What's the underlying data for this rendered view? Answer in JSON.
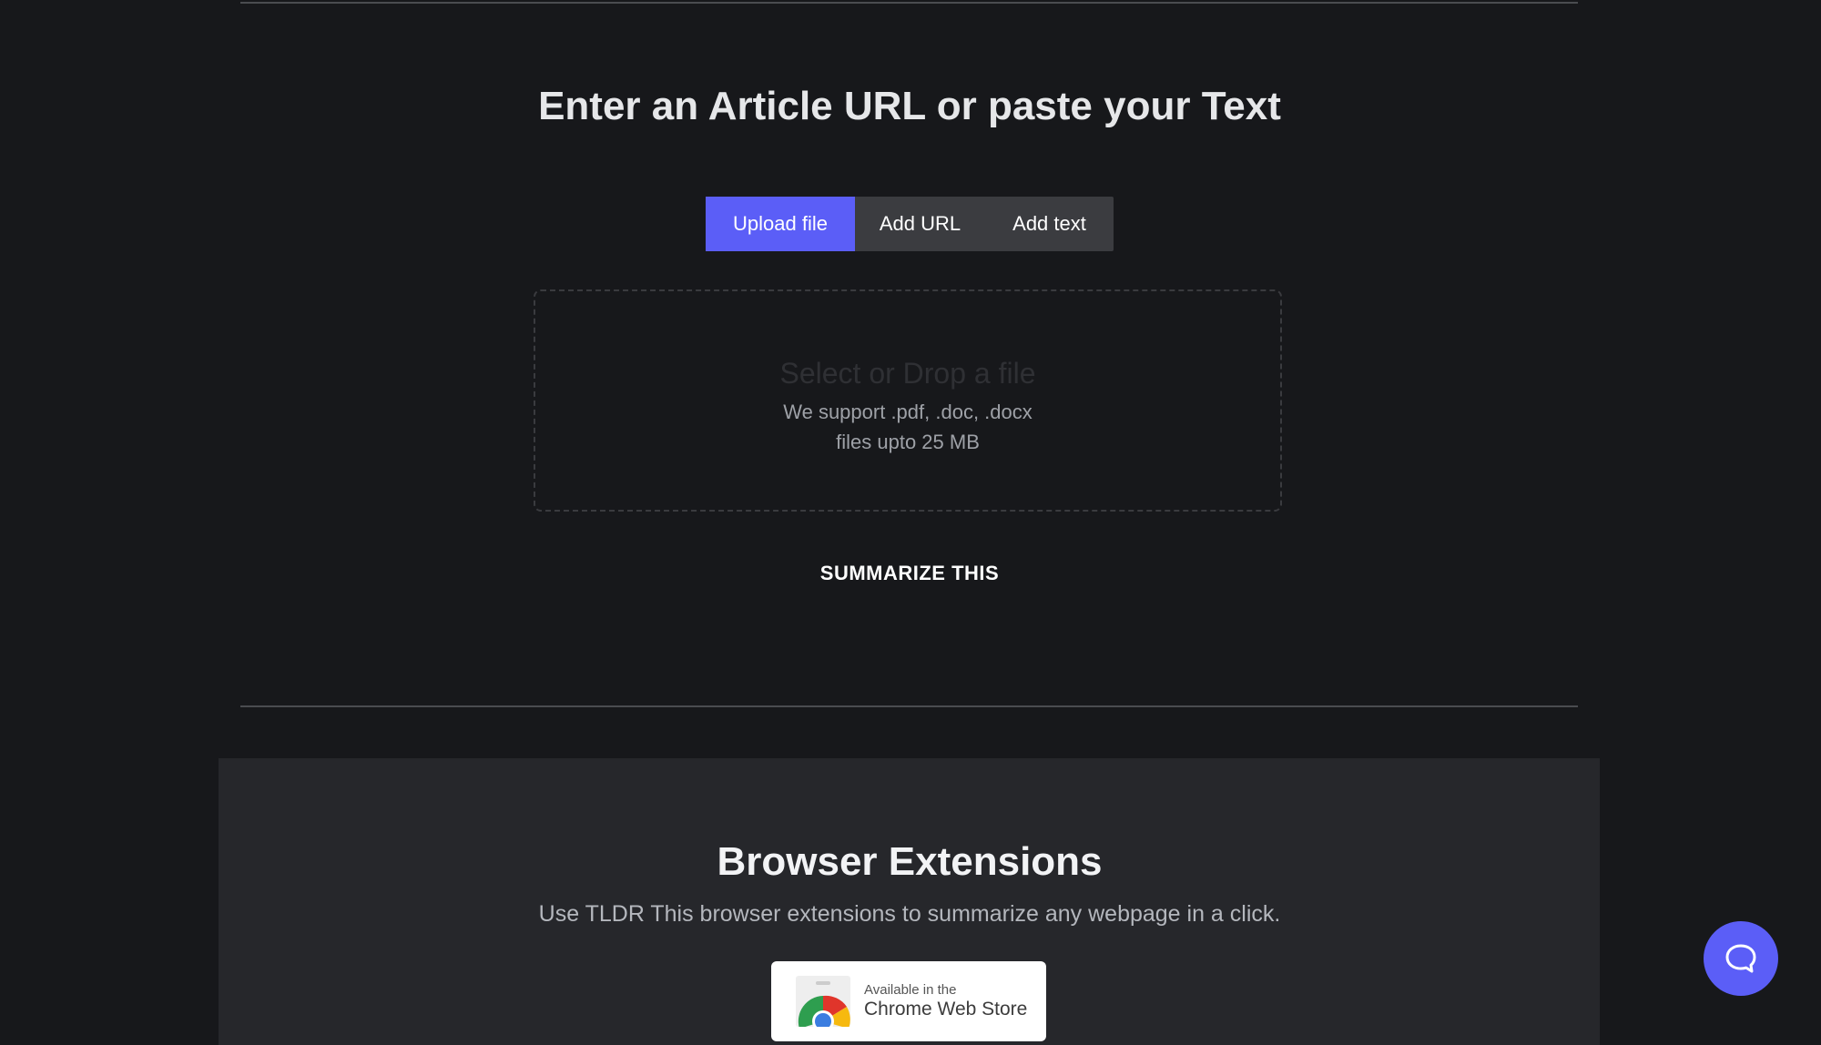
{
  "main": {
    "heading": "Enter an Article URL or paste your Text",
    "tabs": [
      {
        "label": "Upload file",
        "active": true
      },
      {
        "label": "Add URL",
        "active": false
      },
      {
        "label": "Add text",
        "active": false
      }
    ],
    "dropzone": {
      "title": "Select or Drop a file",
      "support_line1": "We support .pdf, .doc, .docx",
      "support_line2": "files upto 25 MB"
    },
    "summarize_label": "SUMMARIZE THIS"
  },
  "extensions": {
    "title": "Browser Extensions",
    "subtitle": "Use TLDR This browser extensions to summarize any webpage in a click.",
    "chrome_badge": {
      "small_text": "Available in the",
      "large_text": "Chrome Web Store",
      "icon": "chrome-web-store-icon"
    }
  },
  "chat": {
    "icon": "chat-bubble-icon"
  },
  "colors": {
    "background": "#17181b",
    "accent": "#5b5ef7",
    "tab_inactive": "#3b3c40",
    "section_background": "#26272b"
  }
}
